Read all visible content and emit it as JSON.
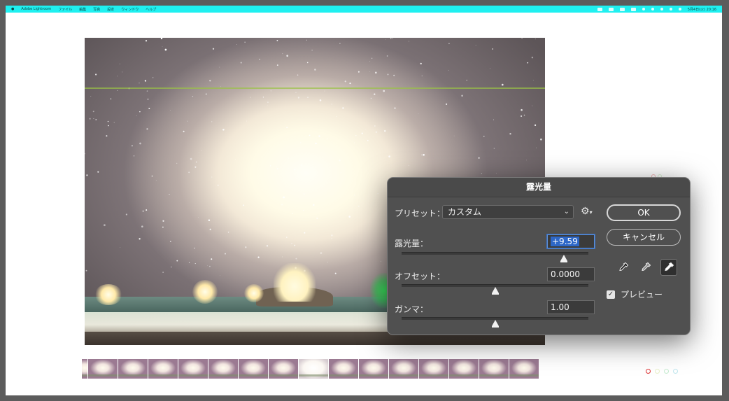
{
  "menubar": {
    "app_name": "Adobe Lightroom",
    "items": [
      "ファイル",
      "編集",
      "写真",
      "設定",
      "ウィンドウ",
      "ヘルプ"
    ],
    "clock": "5月4日(火) 20:16"
  },
  "filmstrip": {
    "thumbnail_count": 16,
    "selected_index": 7
  },
  "dialog": {
    "title": "露光量",
    "preset_label": "プリセット：",
    "preset_value": "カスタム",
    "exposure_label": "露光量：",
    "exposure_value": "+9.59",
    "exposure_slider_fraction": 0.87,
    "offset_label": "オフセット：",
    "offset_value": "0.0000",
    "offset_slider_fraction": 0.5,
    "gamma_label": "ガンマ：",
    "gamma_value": "1.00",
    "gamma_slider_fraction": 0.5,
    "ok_label": "OK",
    "cancel_label": "キャンセル",
    "preview_label": "プレビュー",
    "preview_checked": true,
    "eyedroppers": [
      "black-point-eyedropper-icon",
      "gray-point-eyedropper-icon",
      "white-point-eyedropper-icon"
    ],
    "active_eyedropper": "white-point-eyedropper-icon"
  }
}
